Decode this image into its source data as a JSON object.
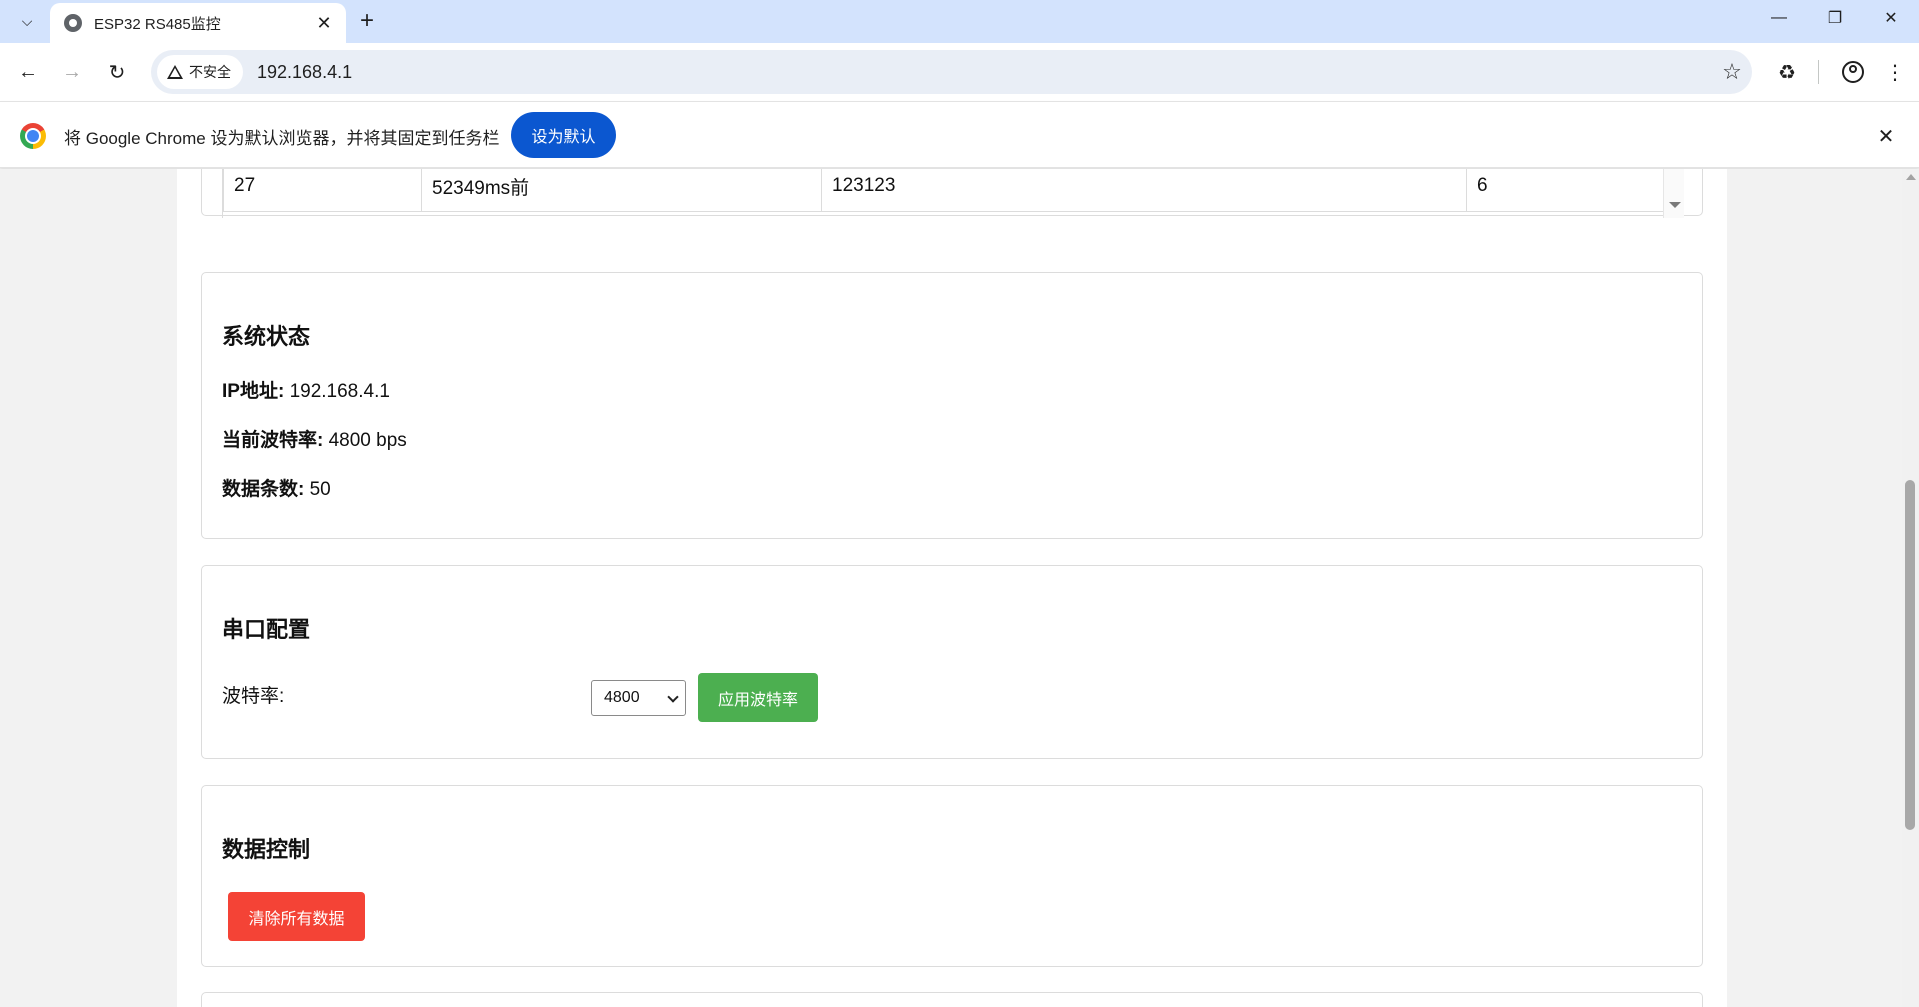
{
  "browser": {
    "tab_title": "ESP32 RS485监控",
    "security_label": "不安全",
    "url": "192.168.4.1",
    "infobar_text": "将 Google Chrome 设为默认浏览器，并将其固定到任务栏",
    "infobar_button": "设为默认"
  },
  "table": {
    "row": [
      "27",
      "52349ms前",
      "123123",
      "6"
    ]
  },
  "system_status": {
    "heading": "系统状态",
    "ip_label": "IP地址:",
    "ip_value": "192.168.4.1",
    "baud_label": "当前波特率:",
    "baud_value": "4800 bps",
    "count_label": "数据条数:",
    "count_value": "50"
  },
  "serial_config": {
    "heading": "串口配置",
    "baud_label": "波特率:",
    "selected_baud": "4800",
    "apply_button": "应用波特率"
  },
  "data_control": {
    "heading": "数据控制",
    "clear_button": "清除所有数据"
  },
  "colors": {
    "apply_button_bg": "#4caf50",
    "clear_button_bg": "#f44336",
    "infobar_button_bg": "#0b57d0",
    "tabstrip_bg": "#d3e3fd"
  },
  "icons": {
    "tab_search": "chevron-down-icon",
    "favicon": "globe-icon",
    "back": "arrow-left-icon",
    "forward": "arrow-right-icon",
    "reload": "reload-icon",
    "warning": "warning-icon",
    "bookmark": "star-icon",
    "extensions": "puzzle-icon",
    "profile": "profile-icon",
    "menu": "kebab-menu-icon"
  }
}
